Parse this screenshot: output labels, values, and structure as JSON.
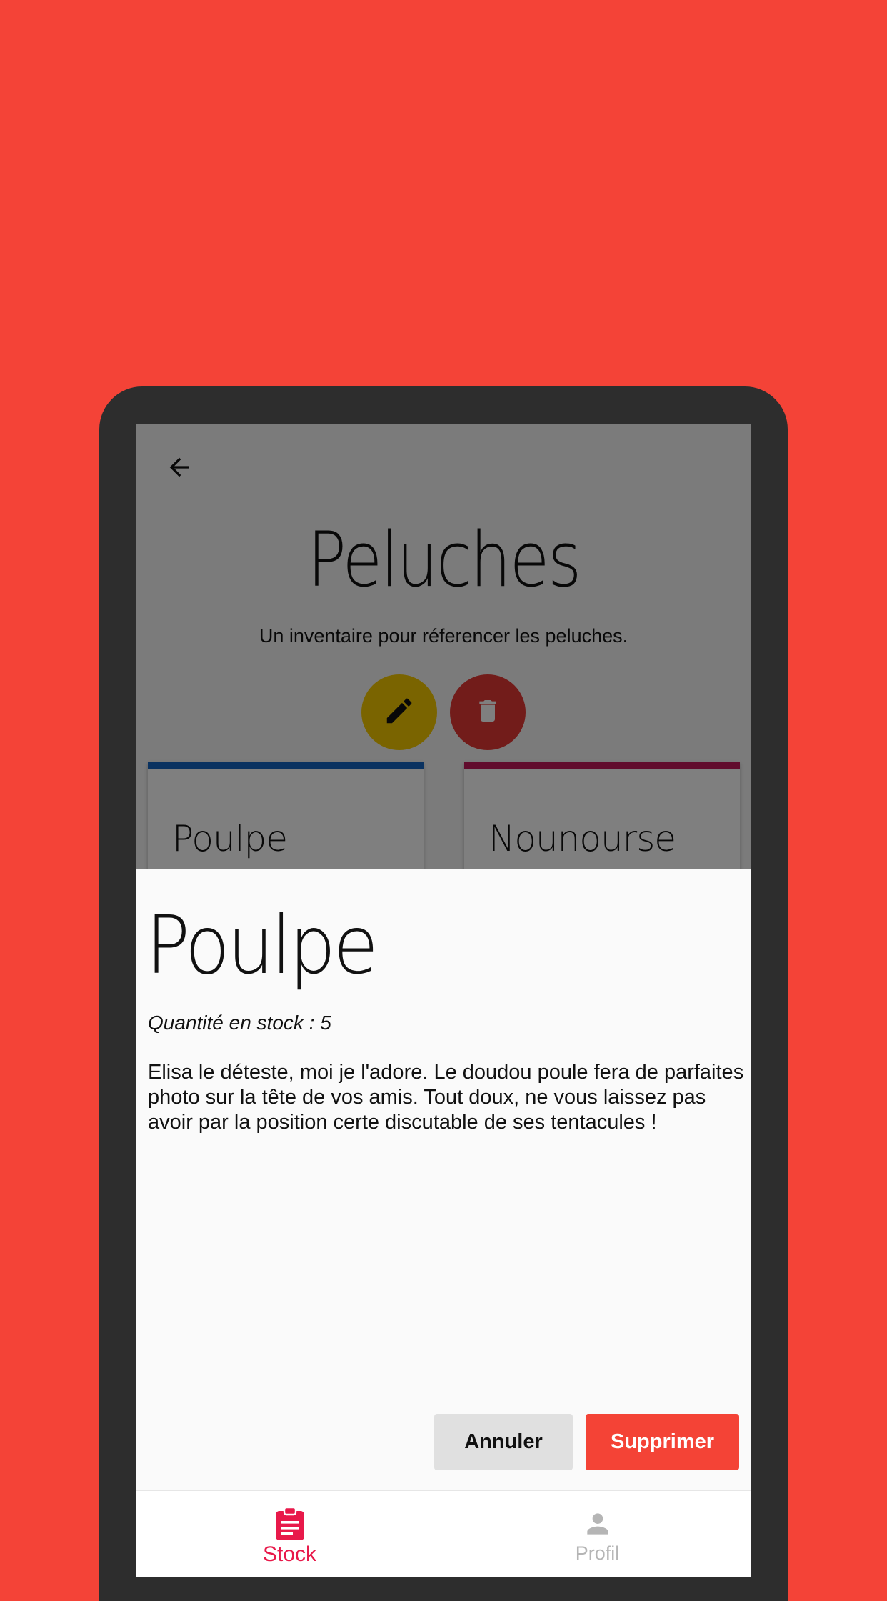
{
  "app": {
    "page_title": "Peluches",
    "page_subtitle": "Un inventaire pour réferencer les peluches.",
    "cards": [
      {
        "title": "Poulpe",
        "accent": "#1565c0"
      },
      {
        "title": "Nounourse",
        "accent": "#c2185b"
      }
    ],
    "icons": {
      "back": "arrow-left-icon",
      "edit": "pencil-icon",
      "delete": "trash-icon"
    }
  },
  "sheet": {
    "title": "Poulpe",
    "quantity": "Quantité en stock : 5",
    "description": "Elisa le déteste, moi je l'adore. Le doudou poule fera de parfaites photo sur la tête de vos amis. Tout doux, ne vous laissez pas avoir par la position certe discutable de ses tentacules !",
    "cancel_label": "Annuler",
    "delete_label": "Supprimer"
  },
  "bottom_nav": {
    "items": [
      {
        "label": "Stock",
        "icon": "clipboard-icon",
        "active": true
      },
      {
        "label": "Profil",
        "icon": "person-icon",
        "active": false
      }
    ]
  },
  "colors": {
    "background": "#f44337",
    "device_frame": "#2d2d2d",
    "edit_fab": "#f5c900",
    "delete_fab": "#e53935",
    "primary_button": "#f44336",
    "nav_active": "#e8194a",
    "nav_inactive": "#b5b5b5"
  }
}
